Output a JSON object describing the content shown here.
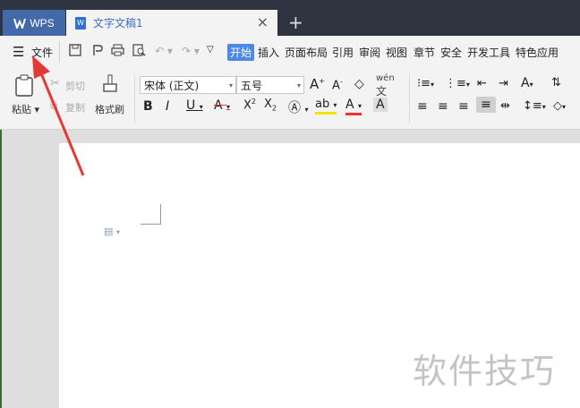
{
  "titlebar": {
    "app_tab": "WPS",
    "doc_tab": "文字文稿1",
    "close": "×",
    "new_tab": "+"
  },
  "menubar": {
    "file": "文件",
    "tabs": [
      "开始",
      "插入",
      "页面布局",
      "引用",
      "审阅",
      "视图",
      "章节",
      "安全",
      "开发工具",
      "特色应用"
    ],
    "active_tab": "开始",
    "active_color": "#4a89e8"
  },
  "ribbon": {
    "paste": "粘贴",
    "cut": "剪切",
    "copy": "复制",
    "format_painter": "格式刷",
    "font_name": "宋体 (正文)",
    "font_size": "五号",
    "phonetic": "wén"
  },
  "document": {
    "watermark": "软件技巧"
  },
  "colors": {
    "arrow": "#e53935",
    "titlebar": "#2e3440",
    "wps_tab": "#4469a8"
  }
}
